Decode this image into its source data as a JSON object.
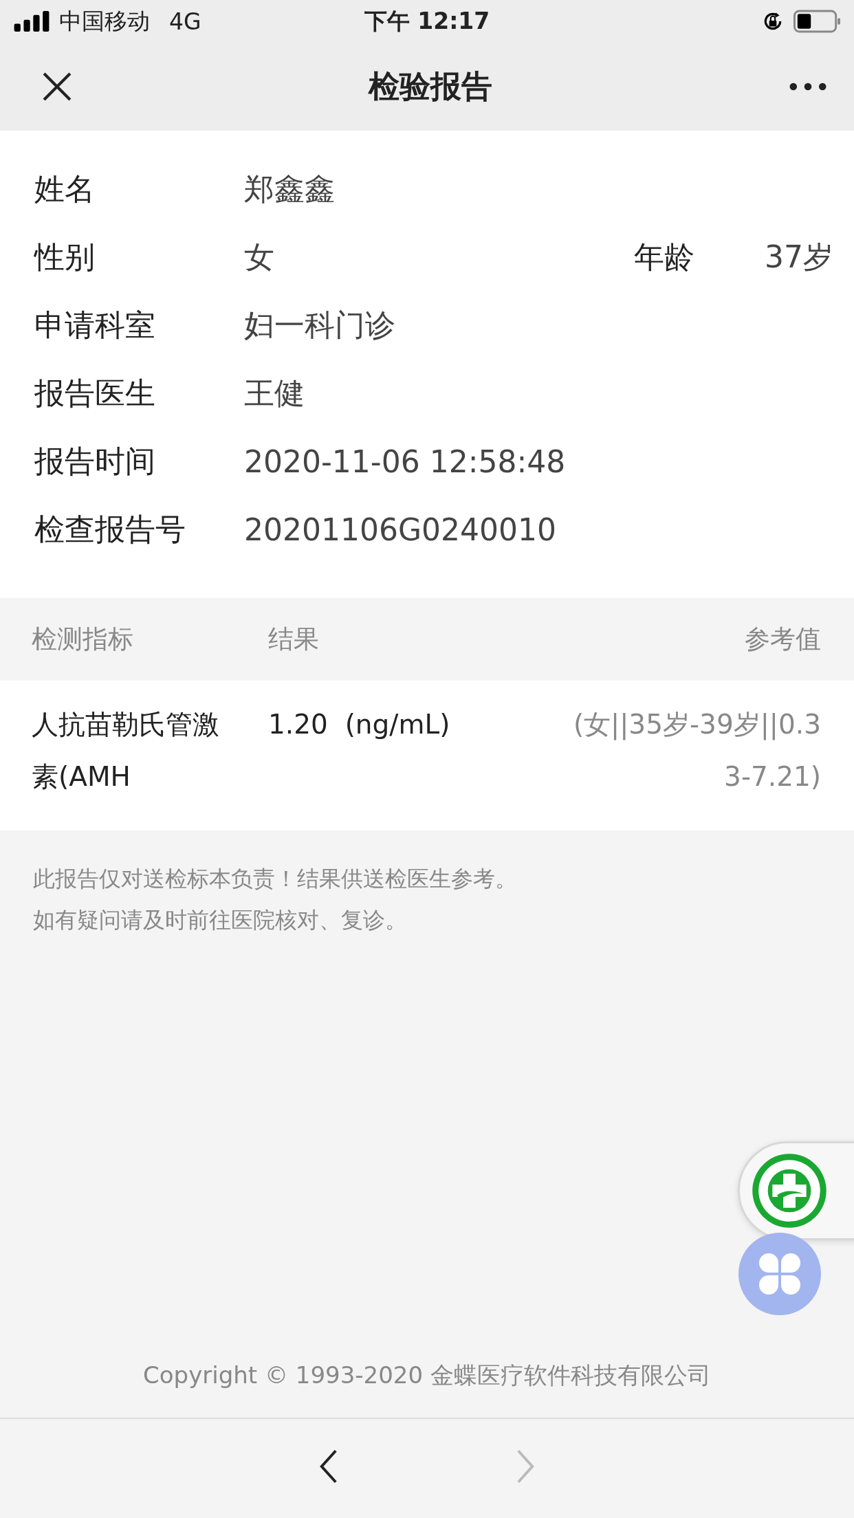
{
  "status_bar": {
    "carrier": "中国移动",
    "network": "4G",
    "time": "下午 12:17"
  },
  "nav": {
    "title": "检验报告"
  },
  "patient_fields": [
    {
      "label": "姓名",
      "value": "郑鑫鑫"
    },
    {
      "label": "性别",
      "value": "女",
      "extra_label": "年龄",
      "extra_value": "37岁"
    },
    {
      "label": "申请科室",
      "value": "妇一科门诊"
    },
    {
      "label": "报告医生",
      "value": "王健"
    },
    {
      "label": "报告时间",
      "value": "2020-11-06 12:58:48"
    },
    {
      "label": "检查报告号",
      "value": "20201106G0240010"
    }
  ],
  "table": {
    "columns": [
      "检测指标",
      "结果",
      "参考值"
    ],
    "rows": [
      {
        "indicator": "人抗苗勒氏管激素(AMH",
        "result": "1.20  (ng/mL)",
        "reference": "(女||35岁-39岁||0.33-7.21)"
      }
    ]
  },
  "notes": [
    "此报告仅对送检标本负责！结果供送检医生参考。",
    "如有疑问请及时前往医院核对、复诊。"
  ],
  "copyright": "Copyright © 1993-2020 金蝶医疗软件科技有限公司",
  "toolbar": {
    "back_disabled": false,
    "forward_disabled": true
  }
}
